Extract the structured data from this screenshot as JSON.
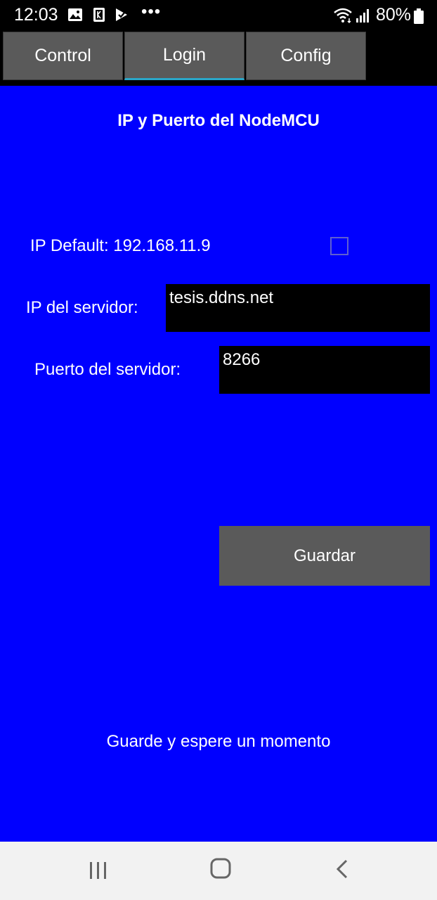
{
  "status_bar": {
    "time": "12:03",
    "battery_percent": "80%",
    "overflow_label": "•••"
  },
  "tabs": [
    {
      "label": "Control",
      "selected": false
    },
    {
      "label": "Login",
      "selected": true
    },
    {
      "label": "Config",
      "selected": false
    }
  ],
  "main": {
    "title": "IP y Puerto del NodeMCU",
    "default_ip_label": "IP Default: 192.168.11.9",
    "default_ip_checked": false,
    "server_ip_label": "IP del servidor:",
    "server_ip_value": "tesis.ddns.net",
    "server_port_label": "Puerto del servidor:",
    "server_port_value": "8266",
    "save_button": "Guardar",
    "hint": "Guarde y espere un momento"
  },
  "colors": {
    "background": "#0000ff",
    "tab": "#5a5a5a",
    "tab_selected_indicator": "#2aa6c8",
    "input_bg": "#000000",
    "nav_bg": "#f2f2f2"
  },
  "icons": [
    "image-icon",
    "k-icon",
    "play-store-icon",
    "wifi-icon",
    "signal-icon",
    "battery-icon",
    "recents-icon",
    "home-icon",
    "back-icon"
  ]
}
